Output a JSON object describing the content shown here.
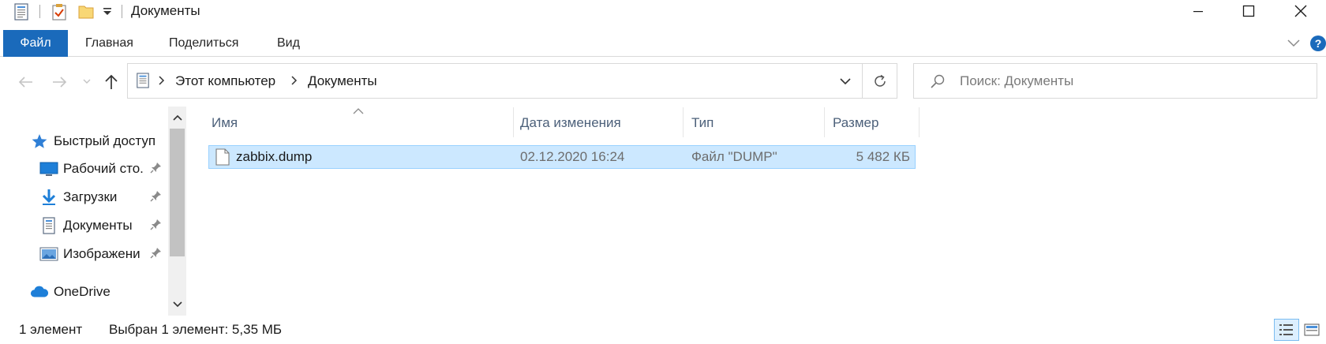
{
  "window": {
    "title": "Документы",
    "icons": {
      "app": "document-folder-icon",
      "properties": "properties-check-icon",
      "new_folder": "new-folder-icon",
      "customize": "dropdown-arrow-icon"
    },
    "controls": {
      "minimize": "minimize-icon",
      "maximize": "maximize-icon",
      "close": "close-icon"
    }
  },
  "ribbon": {
    "tabs": [
      {
        "label": "Файл",
        "active": true
      },
      {
        "label": "Главная"
      },
      {
        "label": "Поделиться"
      },
      {
        "label": "Вид"
      }
    ],
    "expand_icon": "chevron-down-icon",
    "help_icon": "help-icon"
  },
  "address": {
    "crumbs": [
      "Этот компьютер",
      "Документы"
    ],
    "search_placeholder": "Поиск: Документы"
  },
  "nav": {
    "quick_access": "Быстрый доступ",
    "items": [
      {
        "label": "Рабочий сто.",
        "icon": "desktop-icon",
        "pinned": true
      },
      {
        "label": "Загрузки",
        "icon": "downloads-icon",
        "pinned": true
      },
      {
        "label": "Документы",
        "icon": "documents-icon",
        "pinned": true
      },
      {
        "label": "Изображени",
        "icon": "pictures-icon",
        "pinned": true
      }
    ],
    "onedrive": "OneDrive"
  },
  "list": {
    "columns": [
      "Имя",
      "Дата изменения",
      "Тип",
      "Размер"
    ],
    "rows": [
      {
        "name": "zabbix.dump",
        "date": "02.12.2020 16:24",
        "type": "Файл \"DUMP\"",
        "size": "5 482 КБ",
        "selected": true
      }
    ]
  },
  "status": {
    "count": "1 элемент",
    "selection": "Выбран 1 элемент: 5,35 МБ"
  },
  "colors": {
    "accent": "#1a6abb",
    "selection_bg": "#cce8ff",
    "selection_border": "#99d1ff",
    "header_text": "#4c607a"
  }
}
